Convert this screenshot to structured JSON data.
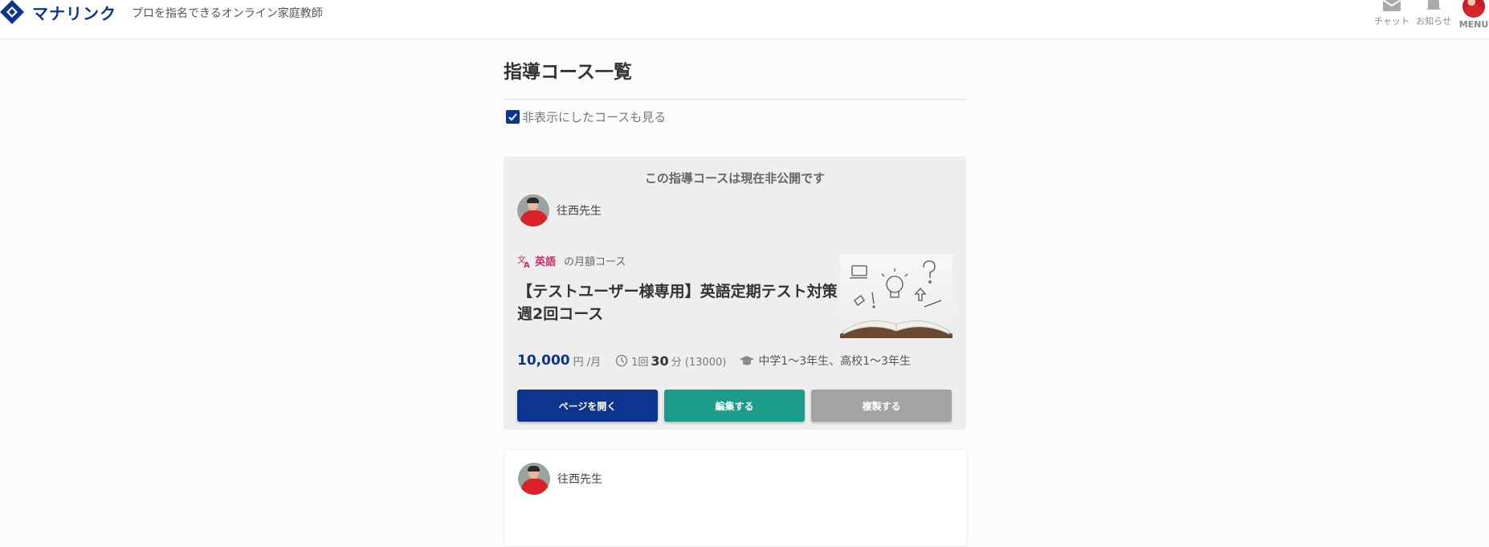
{
  "header": {
    "logo_text": "マナリンク",
    "tagline": "プロを指名できるオンライン家庭教師",
    "nav": {
      "chat_label": "チャット",
      "notifications_label": "お知らせ",
      "menu_label": "MENU"
    }
  },
  "page": {
    "title": "指導コース一覧",
    "filter_label": "非表示にしたコースも見る",
    "filter_checked": true
  },
  "courses": [
    {
      "hidden_notice": "この指導コースは現在非公開です",
      "teacher_name": "往西先生",
      "subject": "英語",
      "course_type": "の月額コース",
      "title": "【テストユーザー様専用】英語定期テスト対策週2回コース",
      "price": "10,000",
      "price_unit": "円 /月",
      "session_prefix": "1回",
      "session_minutes": "30",
      "session_suffix": "分 (13000)",
      "grades": "中学1～3年生、高校1～3年生",
      "buttons": {
        "open": "ページを開く",
        "edit": "編集する",
        "copy": "複製する"
      }
    },
    {
      "teacher_name": "往西先生"
    }
  ],
  "colors": {
    "brand": "#0d3590",
    "edit": "#1c9a8a",
    "copy": "#a3a3a3",
    "subject": "#c8316c"
  }
}
